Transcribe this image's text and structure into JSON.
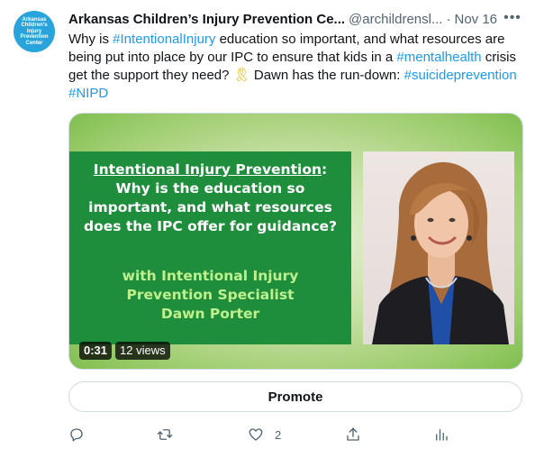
{
  "tweet": {
    "author_name": "Arkansas Children’s Injury Prevention Ce...",
    "handle": "@archildrensl...",
    "separator": "·",
    "date": "Nov 16",
    "more_label": "•••",
    "avatar_lines": [
      "Arkansas",
      "Children's",
      "Injury",
      "Prevention",
      "Center"
    ],
    "avatar_color": "#29a3dc",
    "text": {
      "p1": "Why is ",
      "tag1": "#IntentionalInjury",
      "p2": " education so important, and what resources are being put into place by our IPC to ensure that kids in a ",
      "tag2": "#mentalhealth",
      "p3": " crisis get the support they need? ",
      "emoji": "🎗",
      "p4": " Dawn has the run-down: ",
      "tag3": "#suicideprevention",
      "tag4": "#NIPD"
    },
    "link_color": "#1d9bf0"
  },
  "video": {
    "title_underlined": "Intentional Injury Prevention",
    "title_colon": ":",
    "title_rest": "Why is the education so important, and what resources does the IPC offer for guidance?",
    "subtitle_line1": "with Intentional Injury",
    "subtitle_line2": "Prevention Specialist",
    "subtitle_line3": "Dawn Porter",
    "duration": "0:31",
    "views": "12 views",
    "panel_color": "#1f8e3c",
    "subtitle_color": "#bff08e"
  },
  "promote": {
    "label": "Promote"
  },
  "actions": {
    "reply_icon": "reply-icon",
    "retweet_icon": "retweet-icon",
    "like_icon": "like-icon",
    "like_count": "2",
    "share_icon": "share-icon",
    "analytics_icon": "analytics-icon"
  }
}
